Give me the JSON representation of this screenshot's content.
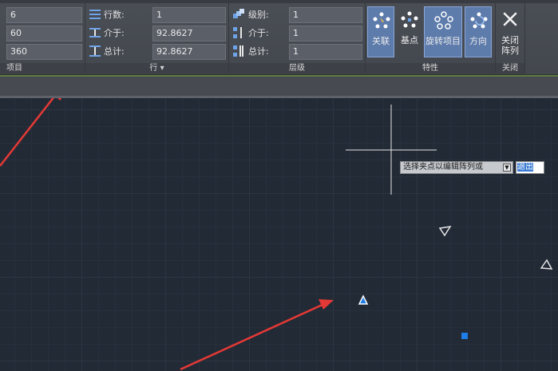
{
  "ribbon": {
    "items_panel": {
      "count_value": "6",
      "between_value": "60",
      "fill_value": "360",
      "title": "项目"
    },
    "rows_panel": {
      "rows_label": "行数:",
      "rows_value": "1",
      "between_label": "介于:",
      "between_value": "92.8627",
      "total_label": "总计:",
      "total_value": "92.8627",
      "title": "行 ▾"
    },
    "levels_panel": {
      "levels_label": "级别:",
      "levels_value": "1",
      "between_label": "介于:",
      "between_value": "1",
      "total_label": "总计:",
      "total_value": "1",
      "title": "层级"
    },
    "properties_panel": {
      "associative_label": "关联",
      "basepoint_label": "基点",
      "rotate_items_label": "旋转项目",
      "direction_label": "方向",
      "title": "特性"
    },
    "close_panel": {
      "close_array_label": "关闭\n阵列",
      "title": "关闭"
    }
  },
  "command": {
    "prompt": "选择夹点以编辑阵列或",
    "input_value": "退出"
  },
  "colors": {
    "annotation_arrow": "#e53935",
    "grip_blue": "#1e7de6",
    "active_button": "#5d7bab"
  }
}
